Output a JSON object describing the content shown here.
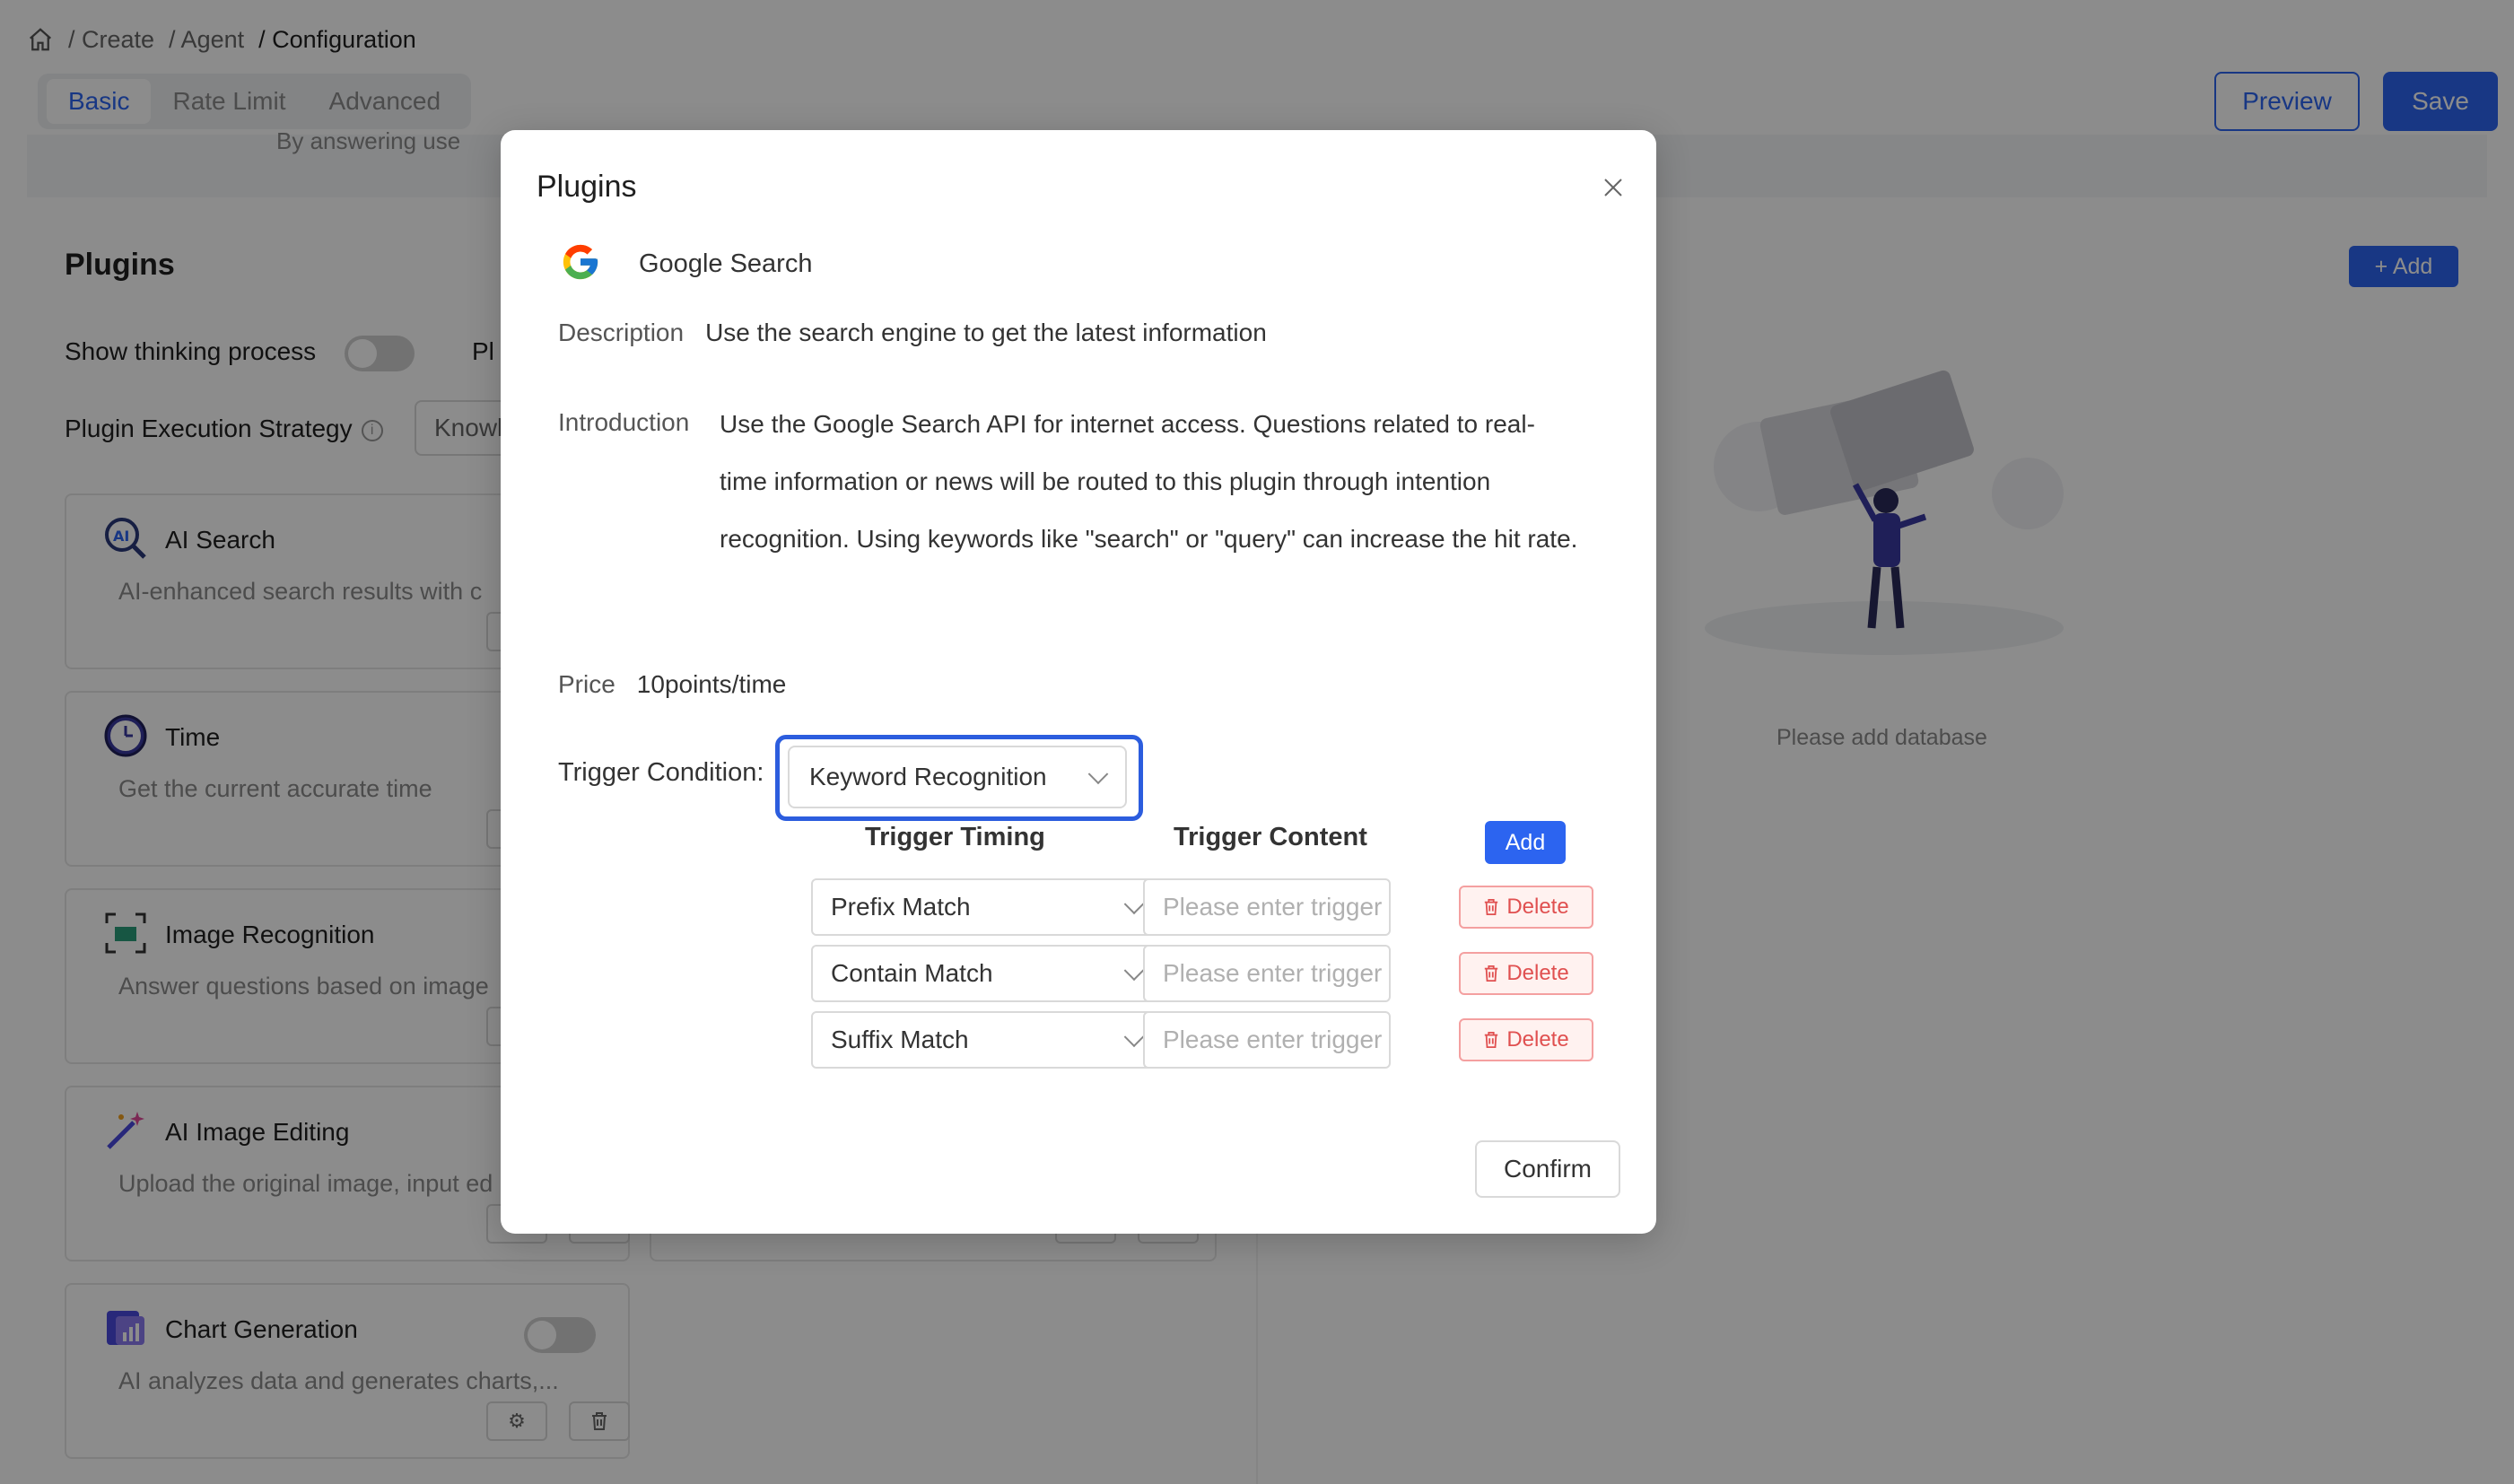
{
  "breadcrumb": [
    "/ Create",
    "/ Agent",
    "/ Configuration"
  ],
  "tabs": [
    {
      "label": "Basic",
      "active": true
    },
    {
      "label": "Rate Limit",
      "active": false
    },
    {
      "label": "Advanced",
      "active": false
    }
  ],
  "actions": {
    "preview": "Preview",
    "save": "Save"
  },
  "background": {
    "cut_text": "By answering use",
    "plugins_title": "Plugins",
    "show_thinking": "Show thinking process",
    "plugin_cut": "Pl",
    "strategy_label": "Plugin Execution Strategy",
    "strategy_value": "Knowl",
    "add_label": "+ Add",
    "empty_text": "Please add database",
    "cards": [
      {
        "title": "AI Search",
        "desc": "AI-enhanced search results with c"
      },
      {
        "title": "Time",
        "desc": "Get the current accurate time"
      },
      {
        "title": "Image Recognition",
        "desc": "Answer questions based on image"
      },
      {
        "title": "AI Image Editing",
        "desc": "Upload the original image, input ed"
      },
      {
        "title": "Chart Generation",
        "desc": "AI analyzes data and generates charts,..."
      }
    ]
  },
  "modal": {
    "title": "Plugins",
    "plugin_name": "Google Search",
    "description_label": "Description",
    "description": "Use the search engine to get the latest information",
    "introduction_label": "Introduction",
    "introduction": "Use the Google Search API for internet access. Questions related to real-time information or news will be routed to this plugin through intention recognition. Using keywords like \"search\" or \"query\" can increase the hit rate.",
    "price_label": "Price",
    "price": "10points/time",
    "trigger_label": "Trigger Condition:",
    "trigger_value": "Keyword Recognition",
    "col_timing": "Trigger Timing",
    "col_content": "Trigger Content",
    "add_label": "Add",
    "rows": [
      {
        "timing": "Prefix Match",
        "placeholder": "Please enter trigger co",
        "delete": "Delete"
      },
      {
        "timing": "Contain Match",
        "placeholder": "Please enter trigger co",
        "delete": "Delete"
      },
      {
        "timing": "Suffix Match",
        "placeholder": "Please enter trigger co",
        "delete": "Delete"
      }
    ],
    "confirm_label": "Confirm"
  },
  "colors": {
    "primary": "#2c64f0",
    "danger": "#e05050",
    "highlight": "#2c5dde",
    "overlay": "rgba(0,0,0,0.45)"
  }
}
